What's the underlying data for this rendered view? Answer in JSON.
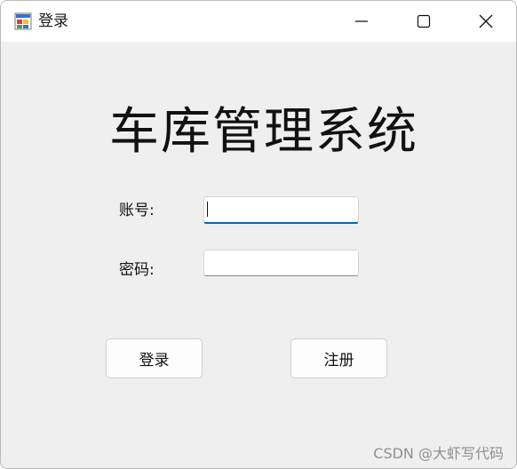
{
  "window": {
    "title": "登录",
    "controls": {
      "minimize": "minimize-icon",
      "maximize": "maximize-icon",
      "close": "close-icon"
    }
  },
  "form": {
    "heading": "车库管理系统",
    "account_label": "账号:",
    "account_value": "",
    "password_label": "密码:",
    "password_value": "",
    "login_button": "登录",
    "register_button": "注册"
  },
  "watermark": "CSDN @大虾写代码",
  "colors": {
    "focus_underline": "#0067c0",
    "window_bg": "#efefef",
    "titlebar_bg": "#ffffff"
  }
}
